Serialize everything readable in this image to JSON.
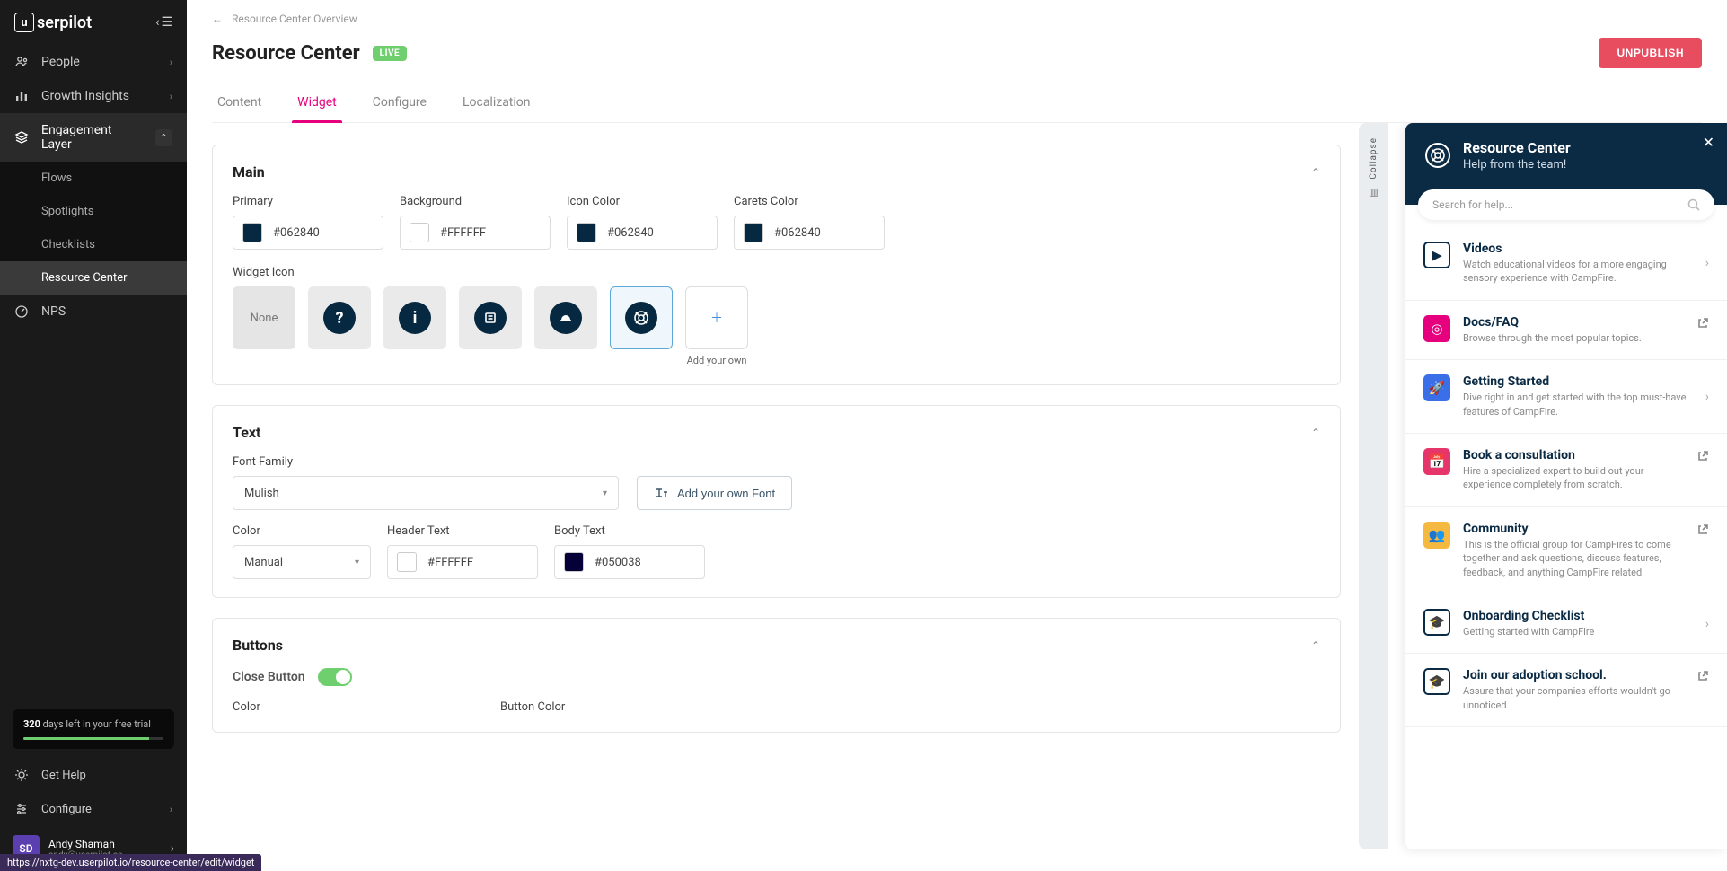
{
  "logo": "serpilot",
  "logo_prefix": "u",
  "sidebar": {
    "people": "People",
    "growth": "Growth Insights",
    "engagement": "Engagement Layer",
    "flows": "Flows",
    "spotlights": "Spotlights",
    "checklists": "Checklists",
    "resource_center": "Resource Center",
    "nps": "NPS",
    "trial_days": "320",
    "trial_text": " days left in your free trial",
    "get_help": "Get Help",
    "configure": "Configure",
    "user_name": "Andy Shamah",
    "user_email": "andy@userpilot.co",
    "user_initials": "SD"
  },
  "breadcrumb": "Resource Center Overview",
  "page_title": "Resource Center",
  "live_badge": "LIVE",
  "unpublish": "UNPUBLISH",
  "tabs": {
    "content": "Content",
    "widget": "Widget",
    "configure": "Configure",
    "localization": "Localization"
  },
  "main_card": {
    "title": "Main",
    "primary_label": "Primary",
    "primary_val": "#062840",
    "background_label": "Background",
    "background_val": "#FFFFFF",
    "icon_color_label": "Icon Color",
    "icon_color_val": "#062840",
    "carets_label": "Carets Color",
    "carets_val": "#062840",
    "widget_icon_label": "Widget Icon",
    "none": "None",
    "add_own": "Add your own"
  },
  "text_card": {
    "title": "Text",
    "font_family_label": "Font Family",
    "font_family_val": "Mulish",
    "add_font": "Add your own Font",
    "color_label": "Color",
    "color_val": "Manual",
    "header_label": "Header Text",
    "header_val": "#FFFFFF",
    "body_label": "Body Text",
    "body_val": "#050038"
  },
  "buttons_card": {
    "title": "Buttons",
    "close_label": "Close Button",
    "color_label": "Color",
    "button_color_label": "Button Color"
  },
  "collapse_label": "Collapse",
  "preview": {
    "title": "Resource Center",
    "subtitle": "Help from the team!",
    "search_placeholder": "Search for help...",
    "items": [
      {
        "title": "Videos",
        "desc": "Watch educational videos for a more engaging sensory experience with CampFire.",
        "icon_bg": "outline",
        "glyph": "▶",
        "action": "chev"
      },
      {
        "title": "Docs/FAQ",
        "desc": "Browse through the most popular topics.",
        "icon_bg": "#e6007e",
        "glyph": "◎",
        "action": "ext"
      },
      {
        "title": "Getting Started",
        "desc": "Dive right in and get started with the top must-have features of CampFire.",
        "icon_bg": "#3a6fe8",
        "glyph": "🚀",
        "action": "chev"
      },
      {
        "title": "Book a consultation",
        "desc": "Hire a specialized expert to build out your experience completely from scratch.",
        "icon_bg": "#e6356b",
        "glyph": "📅",
        "action": "ext"
      },
      {
        "title": "Community",
        "desc": "This is the official group for CampFires to come together and ask questions, discuss features, feedback, and anything CampFire related.",
        "icon_bg": "#f5b942",
        "glyph": "👥",
        "action": "ext"
      },
      {
        "title": "Onboarding Checklist",
        "desc": "Getting started with CampFire",
        "icon_bg": "transparent",
        "glyph": "🎓",
        "action": "chev",
        "outline": true
      },
      {
        "title": "Join our adoption school.",
        "desc": "Assure that your companies efforts wouldn't go unnoticed.",
        "icon_bg": "transparent",
        "glyph": "🎓",
        "action": "ext",
        "outline": true
      }
    ]
  },
  "url_tooltip": "https://nxtg-dev.userpilot.io/resource-center/edit/widget"
}
